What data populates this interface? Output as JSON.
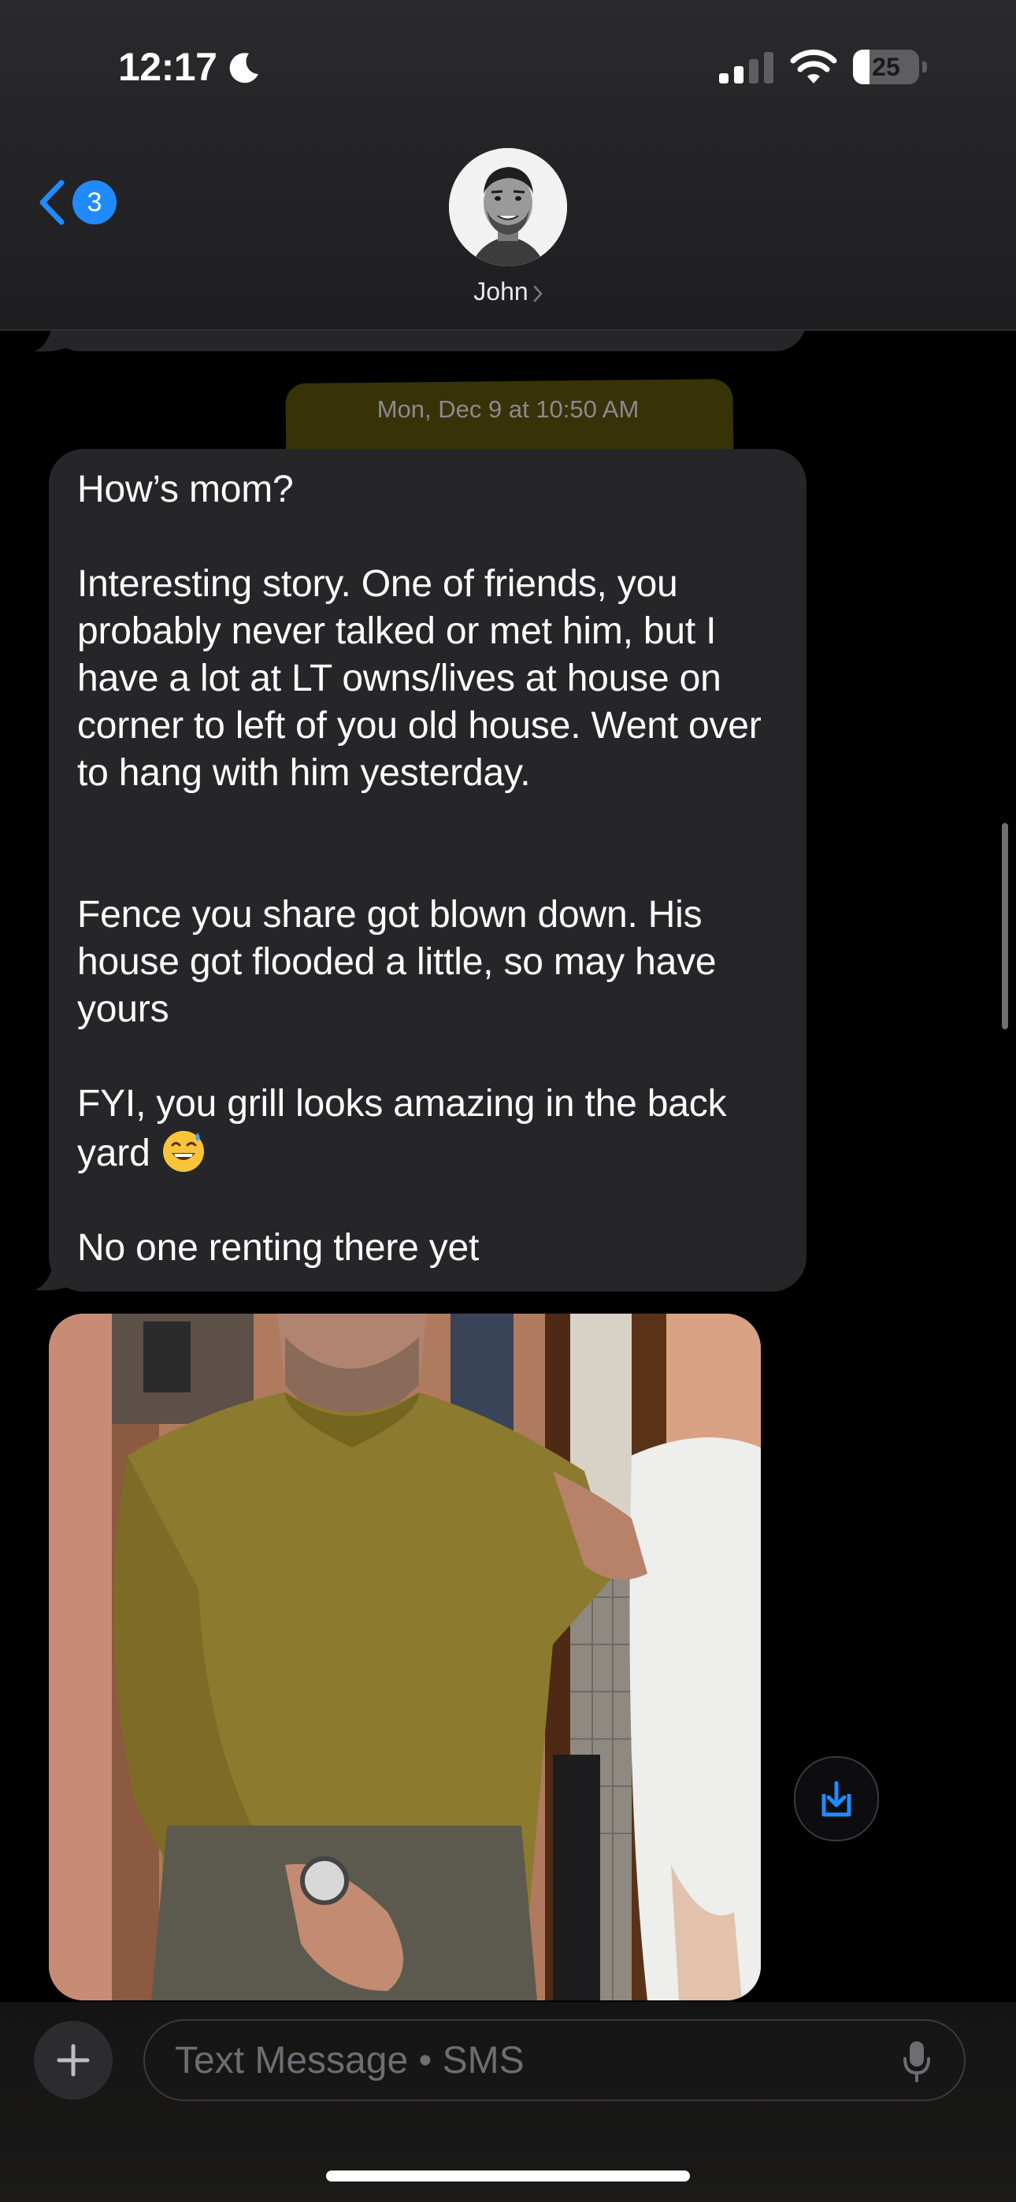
{
  "status_bar": {
    "time": "12:17",
    "battery_level": "25",
    "battery_fraction": 0.25,
    "icons": [
      "moon-icon",
      "signal-icon",
      "wifi-icon",
      "battery-icon"
    ]
  },
  "header": {
    "back_badge_count": "3",
    "contact_name": "John",
    "icons": [
      "back-chevron-icon",
      "contact-chevron-icon"
    ]
  },
  "conversation": {
    "timestamp_day": "Mon, Dec 9",
    "timestamp_at": " at ",
    "timestamp_time": "10:50 AM",
    "message": {
      "text_main": "How’s mom?\n\nInteresting story. One of friends, you probably never talked or met him, but I have a lot at LT owns/lives at house on corner to left of you old house. Went over to hang with him yesterday.\n\n\nFence you share got blown down. His house got flooded a little, so may have yours\n\nFYI, you grill looks amazing in the back yard ",
      "emoji": "grinning-face-with-sweat",
      "text_end": "\n\nNo one renting there yet"
    },
    "attachment": {
      "type": "photo",
      "save_icon": "save-to-downloads-icon"
    }
  },
  "composer": {
    "placeholder": "Text Message • SMS",
    "icons": [
      "plus-icon",
      "microphone-icon"
    ]
  },
  "colors": {
    "accent": "#1f8bff",
    "bubble": "#262628",
    "background": "#000000",
    "highlight": "#c8b41e"
  }
}
